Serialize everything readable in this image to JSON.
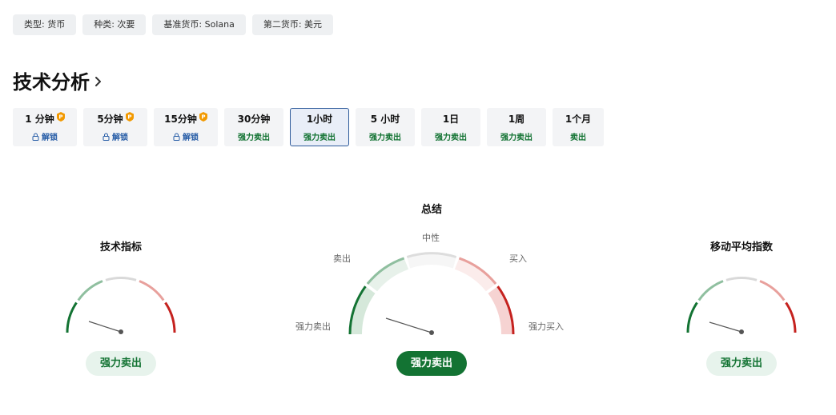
{
  "tags": [
    "类型: 货币",
    "种类: 次要",
    "基准货币: Solana",
    "第二货币: 美元"
  ],
  "section": {
    "title": "技术分析"
  },
  "tabs": [
    {
      "label": "1 分钟",
      "status": "解锁",
      "locked": true
    },
    {
      "label": "5分钟",
      "status": "解锁",
      "locked": true
    },
    {
      "label": "15分钟",
      "status": "解锁",
      "locked": true
    },
    {
      "label": "30分钟",
      "status": "强力卖出",
      "locked": false
    },
    {
      "label": "1小时",
      "status": "强力卖出",
      "locked": false,
      "active": true
    },
    {
      "label": "5 小时",
      "status": "强力卖出",
      "locked": false
    },
    {
      "label": "1日",
      "status": "强力卖出",
      "locked": false
    },
    {
      "label": "1周",
      "status": "强力卖出",
      "locked": false
    },
    {
      "label": "1个月",
      "status": "卖出",
      "locked": false
    }
  ],
  "gauges": {
    "indicators": {
      "title": "技术指标",
      "result": "强力卖出"
    },
    "summary": {
      "title": "总结",
      "result": "强力卖出",
      "labels": {
        "neutral": "中性",
        "sell": "卖出",
        "buy": "买入",
        "strong_sell": "强力卖出",
        "strong_buy": "强力买入"
      }
    },
    "moving_averages": {
      "title": "移动平均指数",
      "result": "强力卖出"
    }
  },
  "colors": {
    "strong_sell": "#137333",
    "sell": "#8fbf9f",
    "neutral": "#d9d9d9",
    "buy": "#e8a09c",
    "strong_buy": "#c5221f",
    "pro_badge": "#f29900"
  }
}
